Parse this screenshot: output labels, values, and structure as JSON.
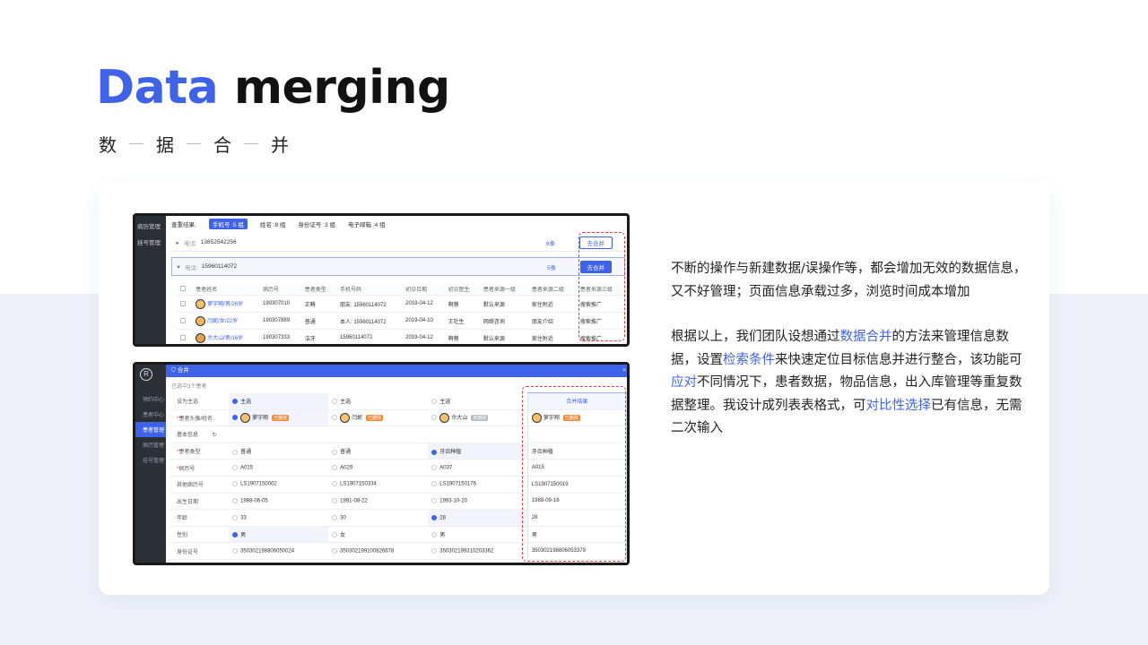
{
  "title": {
    "accent": "Data",
    "rest": "merging"
  },
  "subtitle": [
    "数",
    "据",
    "合",
    "并"
  ],
  "description": {
    "p1": "不断的操作与新建数据/误操作等，都会增加无效的数据信息，又不好管理；页面信息承载过多，浏览时间成本增加",
    "p2_a": "根据以上，我们团队设想通过",
    "p2_h1": "数据合并",
    "p2_b": "的方法来管理信息数据，设置",
    "p2_h2": "检索条件",
    "p2_c": "来快速定位目标信息并进行整合，该功能可",
    "p2_h3": "应对",
    "p2_d": "不同情况下，患者数据，物品信息，出入库管理等重复数据整理。我设计成列表表格式，可",
    "p2_h4": "对比性选择",
    "p2_e": "已有信息，无需二次输入"
  },
  "shot1": {
    "sidebar": [
      "病历管理",
      "挂号管理"
    ],
    "filter_label": "查重结果:",
    "filters": [
      "手机号 :5 组",
      "姓名 :8 组",
      "身份证号 :3 组",
      "电子邮箱 :4 组"
    ],
    "group1": {
      "label": "电话:",
      "value": "13852542256",
      "count": "6条",
      "action": "去合并"
    },
    "group2": {
      "label": "电话:",
      "value": "15960114072",
      "count": "5条",
      "action": "去合并"
    },
    "columns": [
      "患者姓名",
      "病历号",
      "患者类型",
      "手机号码",
      "初诊日期",
      "初诊医生",
      "患者来源一级",
      "患者来源二级",
      "患者来源三级"
    ],
    "rows": [
      {
        "name": "萝宇翔/男/26岁",
        "record": "190307010",
        "type": "正畸",
        "phone": "朋友: 15960114072",
        "date": "2019-04-12",
        "doctor": "啊蔡",
        "src1": "默认来源",
        "src2": "家住附近",
        "src3": "搜索推广"
      },
      {
        "name": "闫妮/女/22岁",
        "record": "190307889",
        "type": "普通",
        "phone": "本人: 15960114072",
        "date": "2019-04-10",
        "doctor": "王牡生",
        "src1": "网络咨询",
        "src2": "朋友介绍",
        "src3": "搜索推广"
      },
      {
        "name": "佘大山/男/16岁",
        "record": "190307333",
        "type": "洁牙",
        "phone": "15960114072",
        "date": "2019-04-12",
        "doctor": "啊蔡",
        "src1": "默认来源",
        "src2": "家住附近",
        "src3": "搜索推广"
      }
    ]
  },
  "shot2": {
    "logo": "R",
    "sidebar": [
      "预约中心",
      "患者中心",
      "患者管理",
      "病历管理",
      "挂号管理"
    ],
    "dialog_title": "合并",
    "close": "×",
    "selected_count": "已选中3个患者",
    "result_header": "合并结果",
    "rows": [
      {
        "label": "设为主选",
        "req": false,
        "c1": "主选",
        "c1_on": true,
        "c2": "主选",
        "c2_on": false,
        "c3": "主选",
        "c3_on": false,
        "res": ""
      },
      {
        "label": "患者头像/姓名",
        "req": true,
        "c1": "萝宇翔",
        "c1_on": true,
        "c1_badge": "已删除",
        "c2": "闫妮",
        "c2_on": false,
        "c2_badge": "已删除",
        "c3": "佘大山",
        "c3_on": false,
        "c3_badge": "未删除",
        "res": "萝宇翔",
        "res_badge": "已删除"
      },
      {
        "label": "基本信息",
        "req": false,
        "c1": "",
        "c2": "",
        "c3": "",
        "res": "",
        "section": true,
        "section_icon": "↻"
      },
      {
        "label": "患者类型",
        "req": true,
        "c1": "普通",
        "c1_on": false,
        "c2": "普通",
        "c2_on": false,
        "c3": "牙齿种植",
        "c3_on": true,
        "res": "牙齿种植"
      },
      {
        "label": "病历号",
        "req": true,
        "c1": "A015",
        "c1_on": false,
        "c2": "A029",
        "c2_on": false,
        "c3": "A037",
        "c3_on": false,
        "res": "A015"
      },
      {
        "label": "其他病历号",
        "req": false,
        "c1": "LS1907150002",
        "c1_on": false,
        "c2": "LS1907150334",
        "c2_on": false,
        "c3": "LS1907150176",
        "c3_on": false,
        "res": "LS1907150019"
      },
      {
        "label": "出生日期",
        "req": false,
        "c1": "1988-06-05",
        "c1_on": false,
        "c2": "1991-08-22",
        "c2_on": false,
        "c3": "1993-10-20",
        "c3_on": false,
        "res": "1988-09-16"
      },
      {
        "label": "年龄",
        "req": false,
        "c1": "33",
        "c1_on": false,
        "c2": "30",
        "c2_on": false,
        "c3": "28",
        "c3_on": true,
        "res": "28"
      },
      {
        "label": "性别",
        "req": false,
        "c1": "男",
        "c1_on": true,
        "c2": "女",
        "c2_on": false,
        "c3": "男",
        "c3_on": false,
        "res": "男"
      },
      {
        "label": "身份证号",
        "req": false,
        "c1": "350302198806050024",
        "c1_on": false,
        "c2": "350302199100826678",
        "c2_on": false,
        "c3": "350302199310203362",
        "c3_on": false,
        "res": "350302198806053379"
      }
    ]
  },
  "colors": {
    "accent": "#3f63e8",
    "dash_red": "#e23b3b",
    "sidebar": "#2b2f36",
    "badge_orange": "#f08a3a"
  }
}
